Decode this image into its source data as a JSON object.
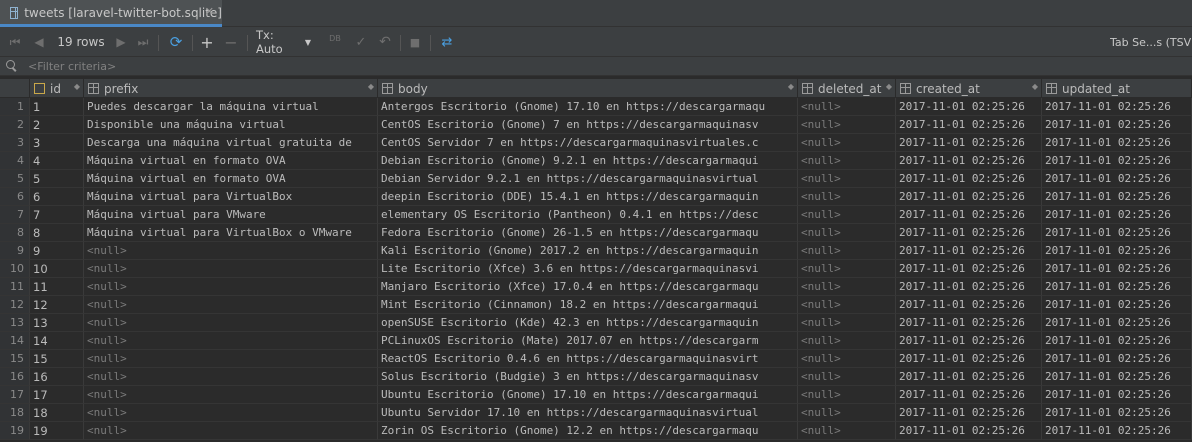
{
  "tab": {
    "title": "tweets [laravel-twitter-bot.sqlite]",
    "close_glyph": "✕"
  },
  "toolbar": {
    "row_count": "19 rows",
    "tx_mode": "Tx: Auto",
    "db_label": "DB",
    "format": "Tab Se...s (TSV)"
  },
  "filter": {
    "placeholder": "<Filter criteria>"
  },
  "columns": [
    "id",
    "prefix",
    "body",
    "deleted_at",
    "created_at",
    "updated_at"
  ],
  "rows": [
    {
      "n": "1",
      "id": "1",
      "prefix": "Puedes descargar la máquina virtual",
      "body": "Antergos Escritorio (Gnome) 17.10 en https://descargarmaqu",
      "deleted_at": "<null>",
      "created_at": "2017-11-01 02:25:26",
      "updated_at": "2017-11-01 02:25:26"
    },
    {
      "n": "2",
      "id": "2",
      "prefix": "Disponible una máquina virtual",
      "body": "CentOS Escritorio (Gnome) 7 en https://descargarmaquinasv",
      "deleted_at": "<null>",
      "created_at": "2017-11-01 02:25:26",
      "updated_at": "2017-11-01 02:25:26"
    },
    {
      "n": "3",
      "id": "3",
      "prefix": "Descarga una máquina virtual gratuita de",
      "body": "CentOS Servidor 7 en https://descargarmaquinasvirtuales.c",
      "deleted_at": "<null>",
      "created_at": "2017-11-01 02:25:26",
      "updated_at": "2017-11-01 02:25:26"
    },
    {
      "n": "4",
      "id": "4",
      "prefix": "Máquina virtual en formato OVA",
      "body": "Debian Escritorio (Gnome) 9.2.1 en https://descargarmaqui",
      "deleted_at": "<null>",
      "created_at": "2017-11-01 02:25:26",
      "updated_at": "2017-11-01 02:25:26"
    },
    {
      "n": "5",
      "id": "5",
      "prefix": "Máquina virtual en formato OVA",
      "body": "Debian Servidor 9.2.1 en https://descargarmaquinasvirtual",
      "deleted_at": "<null>",
      "created_at": "2017-11-01 02:25:26",
      "updated_at": "2017-11-01 02:25:26"
    },
    {
      "n": "6",
      "id": "6",
      "prefix": "Máquina virtual para VirtualBox",
      "body": "deepin Escritorio (DDE) 15.4.1 en https://descargarmaquin",
      "deleted_at": "<null>",
      "created_at": "2017-11-01 02:25:26",
      "updated_at": "2017-11-01 02:25:26"
    },
    {
      "n": "7",
      "id": "7",
      "prefix": "Máquina virtual para VMware",
      "body": "elementary OS Escritorio (Pantheon) 0.4.1 en https://desc",
      "deleted_at": "<null>",
      "created_at": "2017-11-01 02:25:26",
      "updated_at": "2017-11-01 02:25:26"
    },
    {
      "n": "8",
      "id": "8",
      "prefix": "Máquina virtual para VirtualBox o VMware",
      "body": "Fedora Escritorio (Gnome) 26-1.5 en https://descargarmaqu",
      "deleted_at": "<null>",
      "created_at": "2017-11-01 02:25:26",
      "updated_at": "2017-11-01 02:25:26"
    },
    {
      "n": "9",
      "id": "9",
      "prefix": "<null>",
      "body": "Kali Escritorio (Gnome) 2017.2 en https://descargarmaquin",
      "deleted_at": "<null>",
      "created_at": "2017-11-01 02:25:26",
      "updated_at": "2017-11-01 02:25:26"
    },
    {
      "n": "10",
      "id": "10",
      "prefix": "<null>",
      "body": "Lite Escritorio (Xfce) 3.6 en https://descargarmaquinasvi",
      "deleted_at": "<null>",
      "created_at": "2017-11-01 02:25:26",
      "updated_at": "2017-11-01 02:25:26"
    },
    {
      "n": "11",
      "id": "11",
      "prefix": "<null>",
      "body": "Manjaro Escritorio (Xfce) 17.0.4 en https://descargarmaqu",
      "deleted_at": "<null>",
      "created_at": "2017-11-01 02:25:26",
      "updated_at": "2017-11-01 02:25:26"
    },
    {
      "n": "12",
      "id": "12",
      "prefix": "<null>",
      "body": "Mint Escritorio (Cinnamon) 18.2 en https://descargarmaqui",
      "deleted_at": "<null>",
      "created_at": "2017-11-01 02:25:26",
      "updated_at": "2017-11-01 02:25:26"
    },
    {
      "n": "13",
      "id": "13",
      "prefix": "<null>",
      "body": "openSUSE Escritorio (Kde) 42.3 en https://descargarmaquin",
      "deleted_at": "<null>",
      "created_at": "2017-11-01 02:25:26",
      "updated_at": "2017-11-01 02:25:26"
    },
    {
      "n": "14",
      "id": "14",
      "prefix": "<null>",
      "body": "PCLinuxOS Escritorio (Mate) 2017.07 en https://descargarm",
      "deleted_at": "<null>",
      "created_at": "2017-11-01 02:25:26",
      "updated_at": "2017-11-01 02:25:26"
    },
    {
      "n": "15",
      "id": "15",
      "prefix": "<null>",
      "body": "ReactOS Escritorio 0.4.6 en https://descargarmaquinasvirt",
      "deleted_at": "<null>",
      "created_at": "2017-11-01 02:25:26",
      "updated_at": "2017-11-01 02:25:26"
    },
    {
      "n": "16",
      "id": "16",
      "prefix": "<null>",
      "body": "Solus Escritorio (Budgie) 3 en https://descargarmaquinasv",
      "deleted_at": "<null>",
      "created_at": "2017-11-01 02:25:26",
      "updated_at": "2017-11-01 02:25:26"
    },
    {
      "n": "17",
      "id": "17",
      "prefix": "<null>",
      "body": "Ubuntu Escritorio (Gnome) 17.10 en https://descargarmaqui",
      "deleted_at": "<null>",
      "created_at": "2017-11-01 02:25:26",
      "updated_at": "2017-11-01 02:25:26"
    },
    {
      "n": "18",
      "id": "18",
      "prefix": "<null>",
      "body": "Ubuntu Servidor 17.10 en https://descargarmaquinasvirtual",
      "deleted_at": "<null>",
      "created_at": "2017-11-01 02:25:26",
      "updated_at": "2017-11-01 02:25:26"
    },
    {
      "n": "19",
      "id": "19",
      "prefix": "<null>",
      "body": "Zorin OS Escritorio (Gnome) 12.2 en https://descargarmaqu",
      "deleted_at": "<null>",
      "created_at": "2017-11-01 02:25:26",
      "updated_at": "2017-11-01 02:25:26"
    }
  ]
}
